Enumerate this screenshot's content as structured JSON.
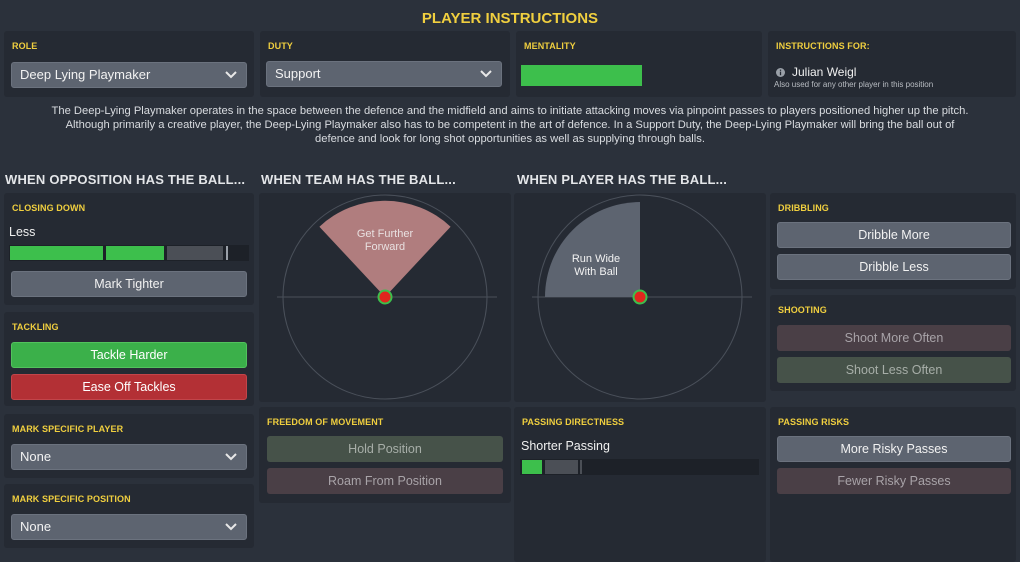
{
  "page_title": "PLAYER INSTRUCTIONS",
  "role": {
    "header": "ROLE",
    "value": "Deep Lying Playmaker"
  },
  "duty": {
    "header": "DUTY",
    "value": "Support"
  },
  "mentality": {
    "header": "MENTALITY",
    "level": 0.55,
    "color": "#3dbf4c"
  },
  "instructions_for": {
    "header": "INSTRUCTIONS FOR:",
    "player": "Julian Weigl",
    "note": "Also used for any other player in this position"
  },
  "description": [
    "The Deep-Lying Playmaker operates in the space between the defence and the midfield and aims to initiate attacking moves via pinpoint passes to players positioned higher up the pitch.",
    "Although primarily a creative player, the Deep-Lying Playmaker also has to be competent in the art of defence. In a Support Duty, the Deep-Lying Playmaker will bring the ball out of",
    "defence and look for long shot opportunities as well as supplying through balls."
  ],
  "sections": {
    "opposition": "WHEN OPPOSITION HAS THE BALL...",
    "team": "WHEN TEAM HAS THE BALL...",
    "player": "WHEN PLAYER HAS THE BALL..."
  },
  "closing_down": {
    "header": "CLOSING DOWN",
    "label": "Less",
    "level": 0.65,
    "button": "Mark Tighter"
  },
  "tackling": {
    "header": "TACKLING",
    "harder": "Tackle Harder",
    "ease_off": "Ease Off Tackles"
  },
  "mark_player": {
    "header": "MARK SPECIFIC PLAYER",
    "value": "None"
  },
  "mark_position": {
    "header": "MARK SPECIFIC POSITION",
    "value": "None"
  },
  "team_radar": {
    "segment_label": [
      "Get Further",
      "Forward"
    ]
  },
  "player_radar": {
    "segment_label": [
      "Run Wide",
      "With Ball"
    ]
  },
  "freedom": {
    "header": "FREEDOM OF MOVEMENT",
    "hold": "Hold Position",
    "roam": "Roam From Position"
  },
  "passing_directness": {
    "header": "PASSING DIRECTNESS",
    "label": "Shorter Passing",
    "level": 0.25
  },
  "dribbling": {
    "header": "DRIBBLING",
    "more": "Dribble More",
    "less": "Dribble Less"
  },
  "shooting": {
    "header": "SHOOTING",
    "more": "Shoot More Often",
    "less": "Shoot Less Often"
  },
  "passing_risks": {
    "header": "PASSING RISKS",
    "more": "More Risky Passes",
    "fewer": "Fewer Risky Passes"
  }
}
